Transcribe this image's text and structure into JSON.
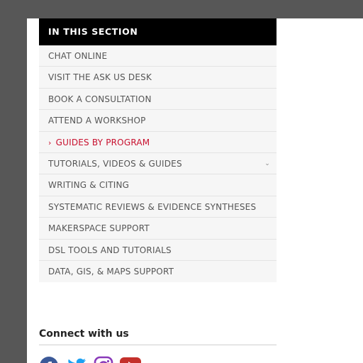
{
  "section_nav": {
    "header": "IN THIS SECTION",
    "items": [
      {
        "label": "CHAT ONLINE"
      },
      {
        "label": "VISIT THE ASK US DESK"
      },
      {
        "label": "BOOK A CONSULTATION"
      },
      {
        "label": "ATTEND A WORKSHOP"
      },
      {
        "label": "GUIDES BY PROGRAM",
        "active": true
      },
      {
        "label": "TUTORIALS, VIDEOS & GUIDES",
        "expandable": true
      },
      {
        "label": "WRITING & CITING"
      },
      {
        "label": "SYSTEMATIC REVIEWS & EVIDENCE SYNTHESES"
      },
      {
        "label": "MAKERSPACE SUPPORT"
      },
      {
        "label": "DSL TOOLS AND TUTORIALS"
      },
      {
        "label": "DATA, GIS, & MAPS SUPPORT"
      }
    ],
    "active_marker": "›",
    "expand_marker": "⌄"
  },
  "connect": {
    "title": "Connect with us",
    "icons": [
      "facebook-icon",
      "twitter-icon",
      "instagram-icon",
      "youtube-icon"
    ]
  },
  "colors": {
    "header_bg": "#000000",
    "active": "#c8102e",
    "nav_bg": "#f6f6f6",
    "facebook": "#3b5998",
    "twitter": "#1da1f2",
    "instagram": "#8a3ab9",
    "youtube": "#c4302b"
  }
}
